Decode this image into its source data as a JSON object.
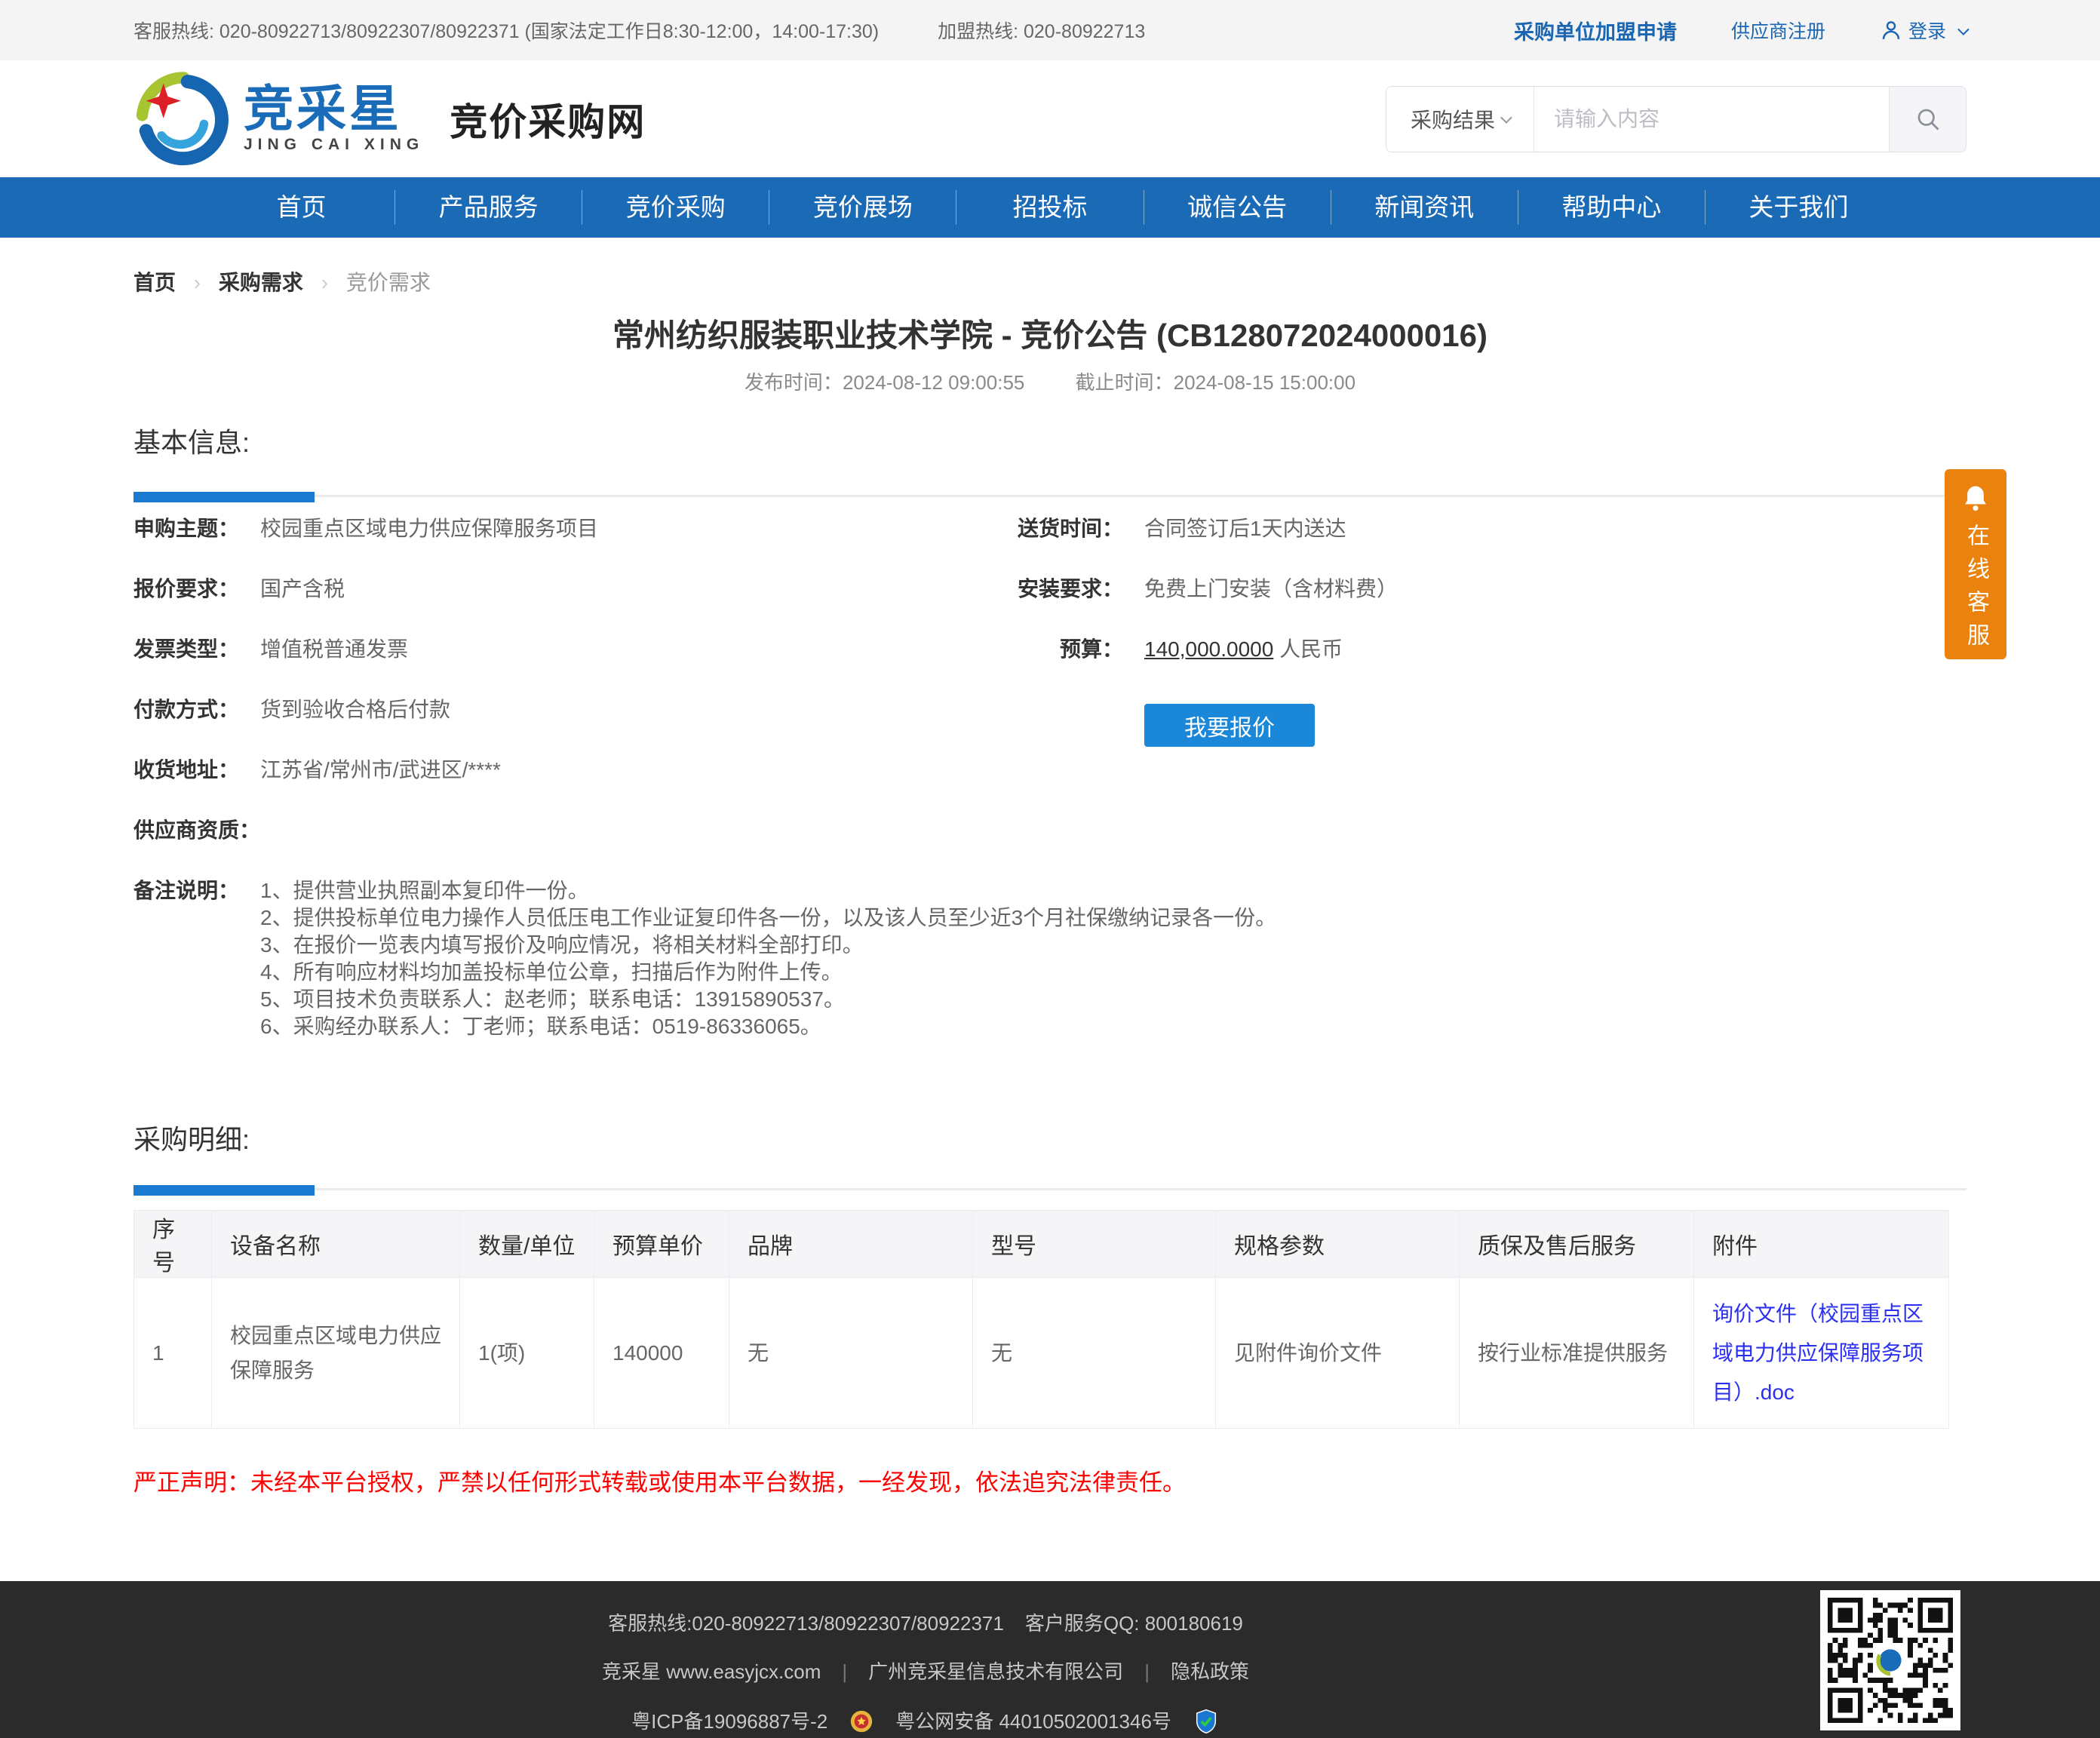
{
  "topbar": {
    "service_hotline": "客服热线: 020-80922713/80922307/80922371 (国家法定工作日8:30-12:00，14:00-17:30)",
    "join_hotline": "加盟热线: 020-80922713",
    "purchaser_join": "采购单位加盟申请",
    "supplier_register": "供应商注册",
    "login": "登录"
  },
  "header": {
    "logo_cn": "竞采星",
    "logo_en": "JING CAI XING",
    "site_name": "竞价采购网",
    "search": {
      "category": "采购结果",
      "placeholder": "请输入内容"
    }
  },
  "nav": {
    "items": [
      "首页",
      "产品服务",
      "竞价采购",
      "竞价展场",
      "招投标",
      "诚信公告",
      "新闻资讯",
      "帮助中心",
      "关于我们"
    ]
  },
  "breadcrumb": {
    "items": [
      "首页",
      "采购需求",
      "竞价需求"
    ]
  },
  "notice": {
    "title": "常州纺织服装职业技术学院 - 竞价公告 (CB128072024000016)",
    "publish_label": "发布时间：",
    "publish_time": "2024-08-12 09:00:55",
    "deadline_label": "截止时间：",
    "deadline_time": "2024-08-15 15:00:00"
  },
  "basic_info": {
    "section_title": "基本信息:",
    "fields_left": [
      {
        "label": "申购主题：",
        "value": "校园重点区域电力供应保障服务项目"
      },
      {
        "label": "报价要求：",
        "value": "国产含税"
      },
      {
        "label": "发票类型：",
        "value": "增值税普通发票"
      },
      {
        "label": "付款方式：",
        "value": "货到验收合格后付款"
      },
      {
        "label": "收货地址：",
        "value": "江苏省/常州市/武进区/****"
      },
      {
        "label": "供应商资质：",
        "value": ""
      }
    ],
    "fields_right": [
      {
        "label": "送货时间：",
        "value": "合同签订后1天内送达"
      },
      {
        "label": "安装要求：",
        "value": "免费上门安装（含材料费）"
      }
    ],
    "budget_label": "预算：",
    "budget_value": "140,000.0000",
    "budget_currency": "人民币",
    "quote_button": "我要报价",
    "remark_label": "备注说明：",
    "remarks": [
      "1、提供营业执照副本复印件一份。",
      "2、提供投标单位电力操作人员低压电工作业证复印件各一份，以及该人员至少近3个月社保缴纳记录各一份。",
      "3、在报价一览表内填写报价及响应情况，将相关材料全部打印。",
      "4、所有响应材料均加盖投标单位公章，扫描后作为附件上传。",
      "5、项目技术负责联系人：赵老师；联系电话：13915890537。",
      "6、采购经办联系人：丁老师；联系电话：0519-86336065。"
    ]
  },
  "detail": {
    "section_title": "采购明细:",
    "columns": [
      "序号",
      "设备名称",
      "数量/单位",
      "预算单价",
      "品牌",
      "型号",
      "规格参数",
      "质保及售后服务",
      "附件"
    ],
    "rows": [
      {
        "seq": "1",
        "name": "校园重点区域电力供应保障服务",
        "qty": "1(项)",
        "unit_price": "140000",
        "brand": "无",
        "model": "无",
        "spec": "见附件询价文件",
        "warranty": "按行业标准提供服务",
        "attachment": "询价文件（校园重点区域电力供应保障服务项目）.doc"
      }
    ]
  },
  "statement": "严正声明：未经本平台授权，严禁以任何形式转载或使用本平台数据，一经发现，依法追究法律责任。",
  "footer": {
    "hotline": "客服热线:020-80922713/80922307/80922371",
    "qq": "客户服务QQ: 800180619",
    "site": "竞采星 www.easyjcx.com",
    "company": "广州竞采星信息技术有限公司",
    "privacy": "隐私政策",
    "icp": "粤ICP备19096887号-2",
    "police": "粤公网安备 44010502001346号"
  },
  "service_tab": {
    "label": "在线客服"
  },
  "colors": {
    "nav_blue": "#1b6ab5",
    "link_blue": "#1a66b3",
    "button_blue": "#1a87d9",
    "section_accent_blue": "#1a7ad2",
    "attachment_link_blue": "#2b2ff2",
    "statement_red": "#ff0000",
    "service_tab_orange": "#ea820d",
    "footer_bg": "#2b2b2b"
  }
}
